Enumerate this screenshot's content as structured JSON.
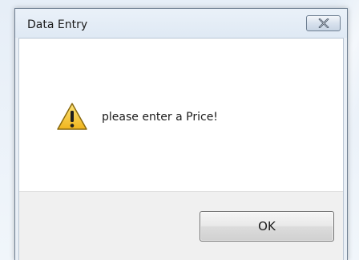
{
  "dialog": {
    "title": "Data Entry",
    "message": "please enter a Price!",
    "ok_label": "OK",
    "icons": {
      "close": "close-icon",
      "warning": "warning-icon"
    },
    "colors": {
      "warning_fill": "#f2c12e",
      "warning_outline": "#8a6a10",
      "button_border": "#707070",
      "frame_border": "#6f7f91"
    }
  }
}
